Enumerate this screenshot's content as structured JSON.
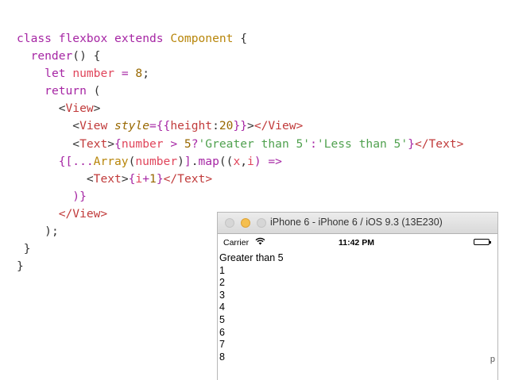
{
  "code": {
    "class_kw": "class",
    "class_name": "flexbox",
    "extends_kw": "extends",
    "parent_class": "Component",
    "open_brace": " {",
    "render_fn": "render",
    "render_sig": "() {",
    "let_kw": "let",
    "number_var": "number",
    "eq": " = ",
    "eight": "8",
    "semi": ";",
    "return_kw": "return",
    "return_paren": " (",
    "lt": "<",
    "gt": ">",
    "view_tag": "View",
    "style_attr": "style",
    "style_expr_open": "={{",
    "height_key": "height",
    "colon": ":",
    "twenty": "20",
    "style_expr_close": "}}",
    "close_view_tag": "</View>",
    "text_tag": "Text",
    "close_text_tag": "</Text>",
    "expr_open": "{",
    "cmp": " > ",
    "five": "5",
    "q": "?",
    "str_greater": "'Greater than 5'",
    "str_less": "'Less than 5'",
    "expr_close": "}",
    "spread_open": "{[",
    "spread": "...",
    "array_fn": "Array",
    "paren_open": "(",
    "paren_close": ")",
    "bracket_close": "]",
    "dot": ".",
    "map_fn": "map",
    "args_open": "((",
    "x_var": "x",
    "comma": ",",
    "i_var": "i",
    "arrow": ") =>",
    "i_plus_open": "{",
    "plus": "+",
    "one": "1",
    "close_paren_brace": ")}",
    "close_return": ");",
    "close_render": "}",
    "close_class": "}"
  },
  "simulator": {
    "title": "iPhone 6 - iPhone 6 / iOS 9.3 (13E230)",
    "carrier": "Carrier",
    "time": "11:42 PM",
    "content_lines": [
      "Greater than 5",
      "1",
      "2",
      "3",
      "4",
      "5",
      "6",
      "7",
      "8"
    ]
  },
  "edge_text": "p"
}
